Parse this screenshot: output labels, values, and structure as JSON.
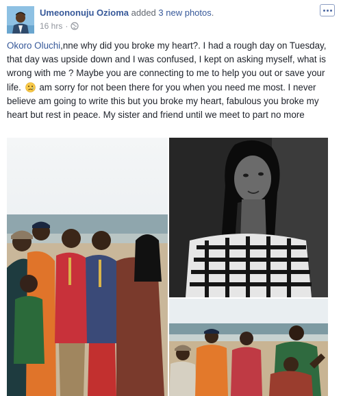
{
  "post": {
    "author": "Umeononuju Ozioma",
    "action_prefix": "added",
    "action_photos": "3 new photos",
    "action_suffix": ".",
    "timestamp": "16 hrs",
    "separator": "·",
    "audience_icon": "globe-icon",
    "more_icon": "ellipsis-icon",
    "text": {
      "mention": "Okoro Oluchi",
      "part1": ",nne why did you broke my heart?. I had a rough day on Tuesday, that day was upside down and I was confused, I kept on asking myself, what is wrong with me ? Maybe you are connecting to me to help you out or save your life.",
      "emoji": "sad-face-emoji",
      "part2": "am sorry for not been there for you when you need me most. I never believe am going to write this but you broke my heart, fabulous you broke my heart but rest in peace. My sister and friend until we meet to part no more"
    },
    "photos": [
      {
        "kind": "group-on-beach"
      },
      {
        "kind": "portrait-black-and-white"
      },
      {
        "kind": "group-on-beach-wide"
      }
    ]
  },
  "colors": {
    "link": "#365899",
    "text": "#1d2129",
    "meta": "#90949c"
  }
}
